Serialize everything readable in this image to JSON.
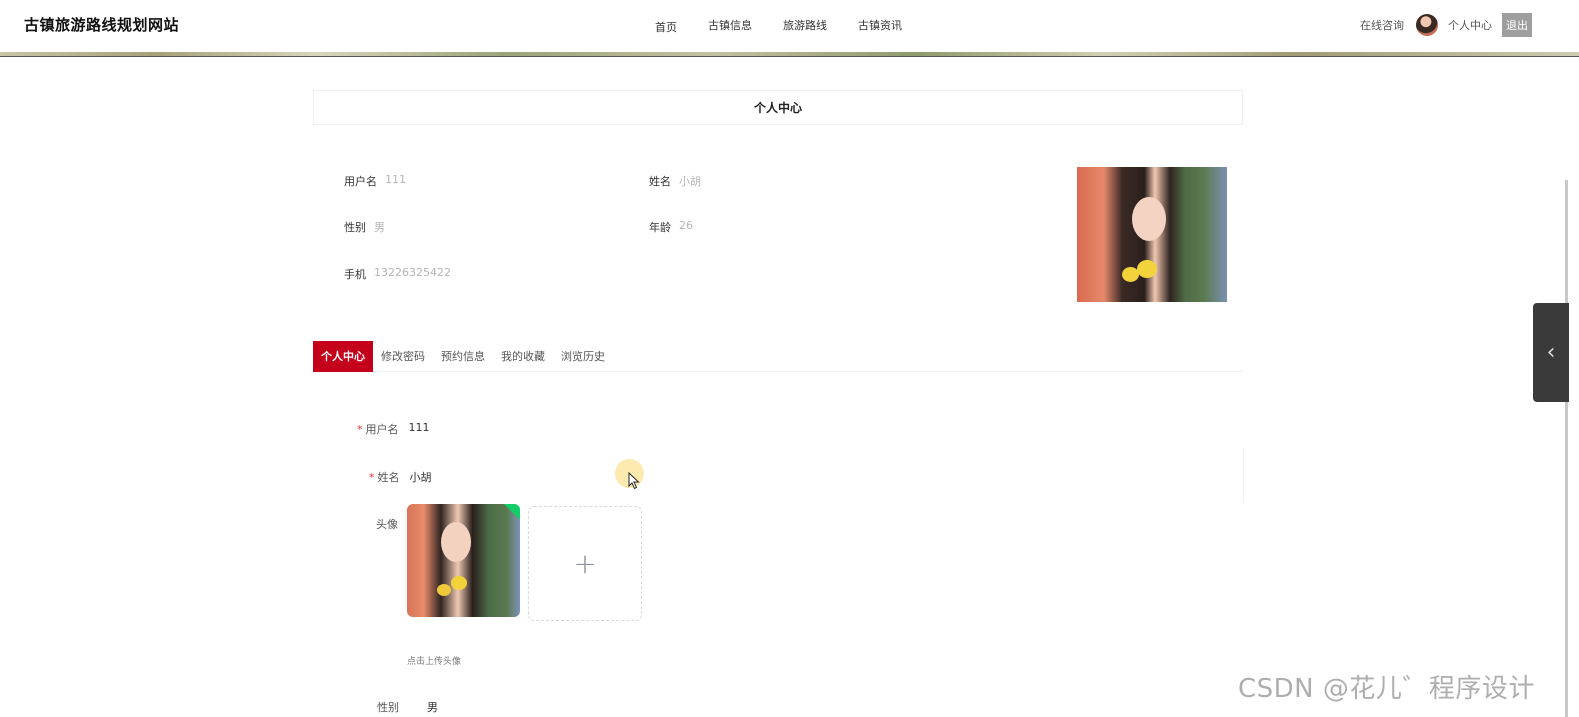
{
  "header": {
    "site_title": "古镇旅游路线规划网站",
    "nav": [
      "首页",
      "古镇信息",
      "旅游路线",
      "古镇资讯"
    ],
    "consult": "在线咨询",
    "user_center": "个人中心",
    "logout": "退出"
  },
  "page_title": "个人中心",
  "profile_info": {
    "username": {
      "label": "用户名",
      "value": "111"
    },
    "name": {
      "label": "姓名",
      "value": "小胡"
    },
    "gender": {
      "label": "性别",
      "value": "男"
    },
    "age": {
      "label": "年龄",
      "value": "26"
    },
    "phone": {
      "label": "手机",
      "value": "13226325422"
    }
  },
  "tabs": [
    "个人中心",
    "修改密码",
    "预约信息",
    "我的收藏",
    "浏览历史"
  ],
  "form": {
    "username": {
      "label": "用户名",
      "value": "111"
    },
    "name": {
      "label": "姓名",
      "value": "小胡"
    },
    "avatar": {
      "label": "头像",
      "upload_plus": "+",
      "hint": "点击上传头像"
    },
    "gender": {
      "label": "性别",
      "value": "男"
    }
  },
  "side_toggle_icon": "‹",
  "watermark": "CSDN @花儿゛程序设计",
  "colors": {
    "accent": "#c4001a",
    "logout_bg": "#9e9e9e",
    "upload_success": "#13ce66"
  }
}
